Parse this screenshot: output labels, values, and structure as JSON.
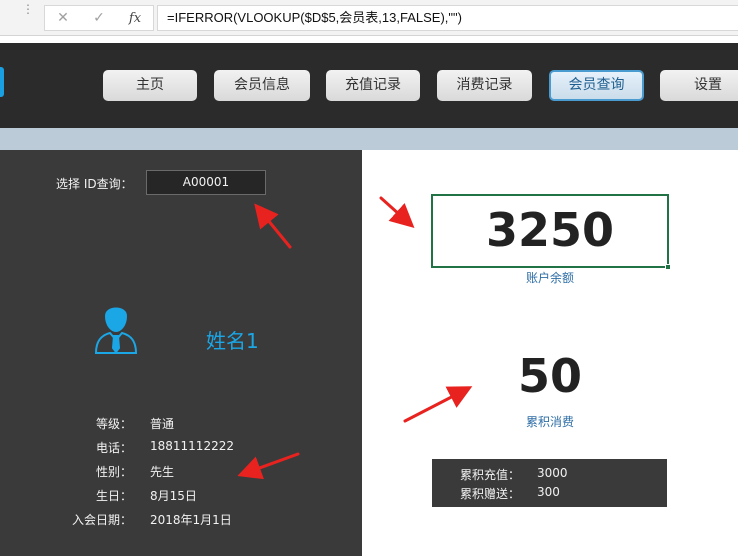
{
  "formula_bar": {
    "cancel_icon": "close-icon",
    "confirm_icon": "check-icon",
    "fx_label": "fx",
    "formula": "=IFERROR(VLOOKUP($D$5,会员表,13,FALSE),\"\")"
  },
  "nav": {
    "items": [
      {
        "label": "主页"
      },
      {
        "label": "会员信息"
      },
      {
        "label": "充值记录"
      },
      {
        "label": "消费记录"
      },
      {
        "label": "会员查询",
        "active": true
      },
      {
        "label": "设置"
      }
    ],
    "accent_color": "#1aa0e0"
  },
  "query": {
    "label": "选择 ID查询：",
    "id_value": "A00001"
  },
  "member": {
    "avatar_icon": "user-avatar-icon",
    "name": "姓名1",
    "name_color": "#1ba6e6"
  },
  "info": [
    {
      "key": "等级：",
      "value": "普通"
    },
    {
      "key": "电话：",
      "value": "18811112222"
    },
    {
      "key": "性别：",
      "value": "先生"
    },
    {
      "key": "生日：",
      "value": "8月15日"
    },
    {
      "key": "入会日期：",
      "value": "2018年1月1日"
    }
  ],
  "balance": {
    "value": "3250",
    "label": "账户余额"
  },
  "consumption": {
    "value": "50",
    "label": "累积消费"
  },
  "summary": [
    {
      "key": "累积充值：",
      "value": "3000"
    },
    {
      "key": "累积赠送：",
      "value": "300"
    }
  ],
  "colors": {
    "dark_panel": "#3a3a3a",
    "selection_border": "#217346",
    "annotation_arrow": "#e8231f"
  }
}
